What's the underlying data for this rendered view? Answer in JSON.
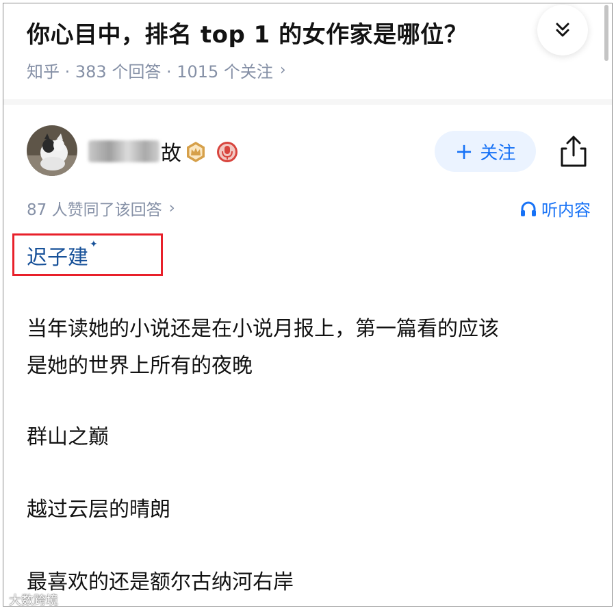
{
  "question": {
    "title": "你心目中，排名 top 1 的女作家是哪位？",
    "meta": "知乎 · 383 个回答 · 1015 个关注",
    "meta_chevron": "›"
  },
  "author": {
    "name_visible_char": "故",
    "follow_label": "关注",
    "follow_plus": "+"
  },
  "answer": {
    "likes": "87 人赞同了该回答",
    "likes_chevron": "›",
    "listen_label": "听内容",
    "link_text": "迟子建",
    "link_mark": "✦",
    "paragraphs": [
      "当年读她的小说还是在小说月报上，第一篇看的应该",
      "是她的世界上所有的夜晚",
      "群山之巅",
      "越过云层的晴朗",
      "最喜欢的还是额尔古纳河右岸"
    ]
  },
  "watermark": "大数跨境",
  "colors": {
    "brand_blue": "#1772f6",
    "link_blue": "#175199",
    "meta_gray": "#8590a6",
    "highlight_red": "#e8202a"
  },
  "icons": [
    "chevron-double-down-icon",
    "share-icon",
    "headphones-icon",
    "crown-badge-icon",
    "mic-badge-icon"
  ]
}
